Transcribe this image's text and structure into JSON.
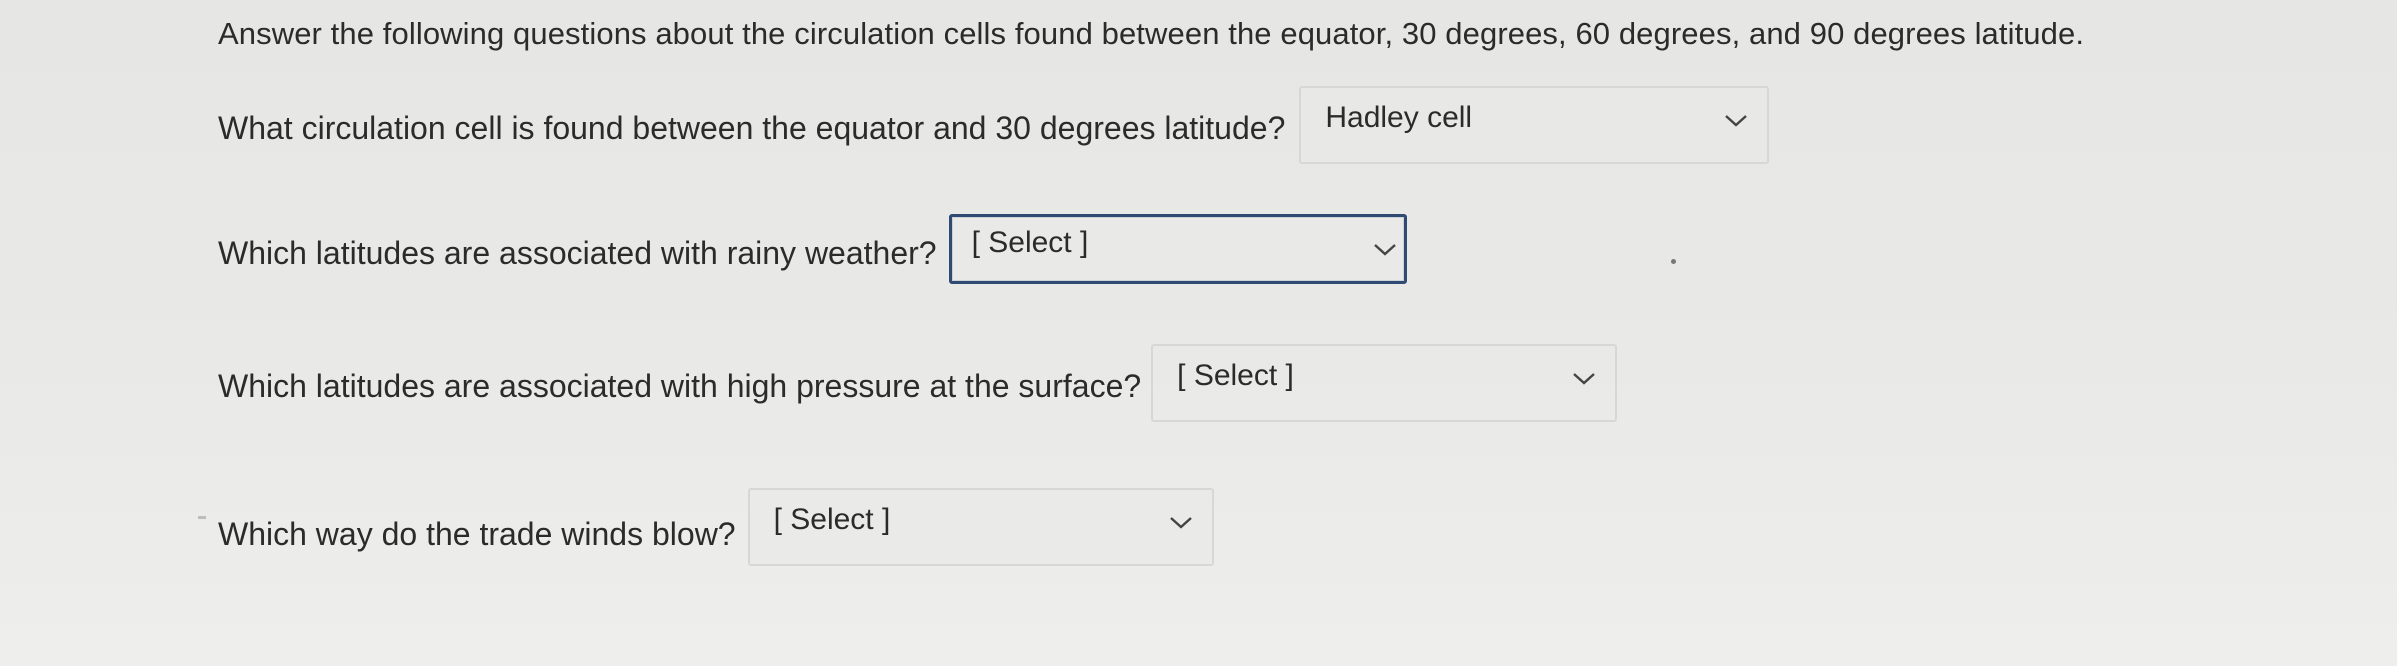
{
  "intro": "Answer the following questions about the circulation cells found between the equator, 30 degrees, 60 degrees, and 90 degrees latitude.",
  "questions": [
    {
      "text": "What circulation cell is found between the equator and 30 degrees latitude?",
      "selected": "Hadley cell"
    },
    {
      "text": "Which latitudes are associated with rainy weather?",
      "selected": "[ Select ]"
    },
    {
      "text": "Which latitudes are associated with high pressure at the surface?",
      "selected": "[ Select ]"
    },
    {
      "text": "Which way do the trade winds blow?",
      "selected": "[ Select ]"
    }
  ],
  "icons": {
    "dropdown": "chevron-down-icon"
  },
  "colors": {
    "focus_border": "#2f4b73",
    "border": "#d7d7d5",
    "text": "#2b2b2b"
  }
}
